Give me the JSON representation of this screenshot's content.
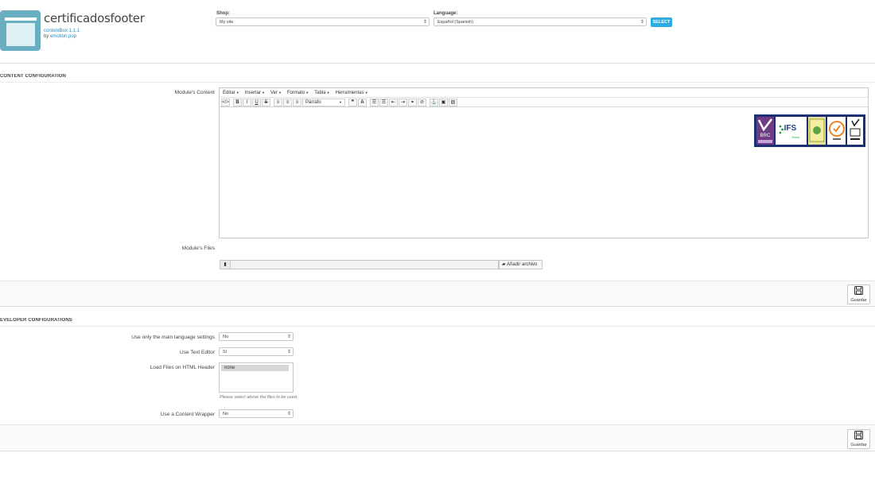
{
  "module": {
    "title": "certificadosfooter",
    "version": "contentBox 1.1.1",
    "by_prefix": "by ",
    "author": "emotion.pop"
  },
  "header": {
    "shop_label": "Shop:",
    "shop_value": "My site",
    "language_label": "Language:",
    "language_value": "Español (Spanish)",
    "select_button": "SELECT"
  },
  "content_config": {
    "heading": "CONTENT CONFIGURATION",
    "content_label": "Module's Content",
    "files_label": "Module's Files",
    "file_button": "Añadir archivo",
    "save_label": "Guardar"
  },
  "editor": {
    "menu": [
      "Editar",
      "Insertar",
      "Ver",
      "Formato",
      "Tabla",
      "Herramientas"
    ],
    "paragraph_select": "Párrafo",
    "content_image_labels": [
      "BRC",
      "IFS",
      "Food"
    ]
  },
  "developer_config": {
    "heading": "EVELOPER CONFIGURATIONS",
    "main_lang_label": "Use only the main language settings",
    "main_lang_value": "No",
    "text_editor_label": "Use Text Editor",
    "text_editor_value": "Sí",
    "load_files_label": "Load Files on HTML Header",
    "load_files_option": "none",
    "load_files_help": "Please select above the files to be used.",
    "wrapper_label": "Use a Content Wrapper",
    "wrapper_value": "No",
    "save_label": "Guardar"
  },
  "colors": {
    "accent": "#2eacdf",
    "logo": "#6aaec2",
    "cert_banner": "#1d2f73"
  }
}
